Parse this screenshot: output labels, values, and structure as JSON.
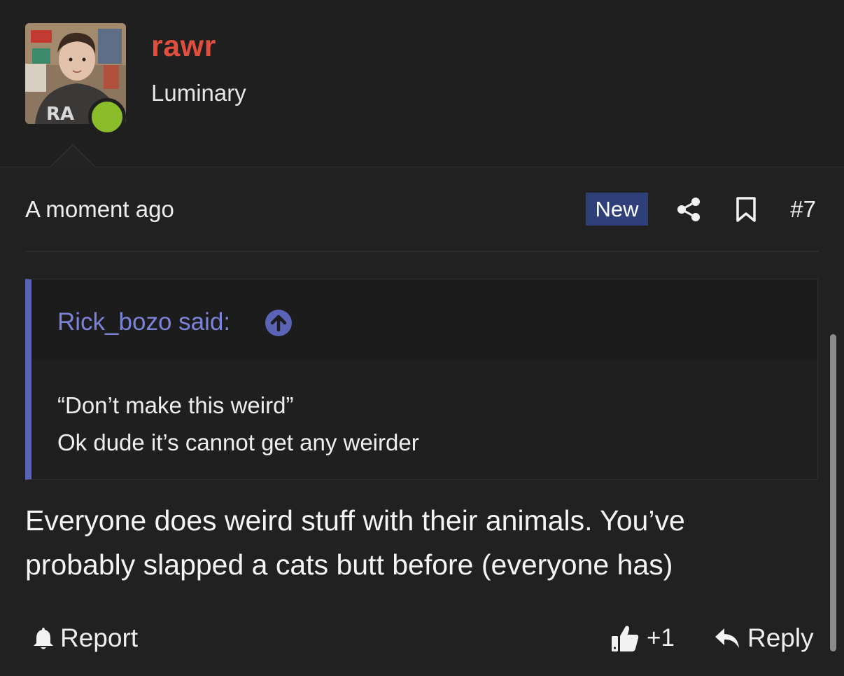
{
  "user": {
    "name": "rawr",
    "title": "Luminary",
    "avatar_icon": "user-avatar-photo",
    "online": true,
    "name_color": "#e04e3d",
    "online_color": "#8bbd2a"
  },
  "post": {
    "timestamp": "A moment ago",
    "badge": "New",
    "badge_color": "#2f3f7a",
    "share_icon": "share-icon",
    "bookmark_icon": "bookmark-icon",
    "number": "#7"
  },
  "quote": {
    "author": "Rick_bozo said:",
    "author_color": "#7b83d9",
    "arrow_icon": "arrow-up-circle-icon",
    "lines": [
      "“Don’t make this weird”",
      "Ok dude it’s cannot get any weirder"
    ]
  },
  "message": {
    "lines": [
      "Everyone does weird stuff with their animals. You’ve",
      "probably slapped a cats butt before (everyone has)"
    ]
  },
  "actions": {
    "report_label": "Report",
    "report_icon": "bell-icon",
    "like_count": "+1",
    "like_icon": "thumbs-up-icon",
    "reply_label": "Reply",
    "reply_icon": "reply-arrow-icon"
  }
}
